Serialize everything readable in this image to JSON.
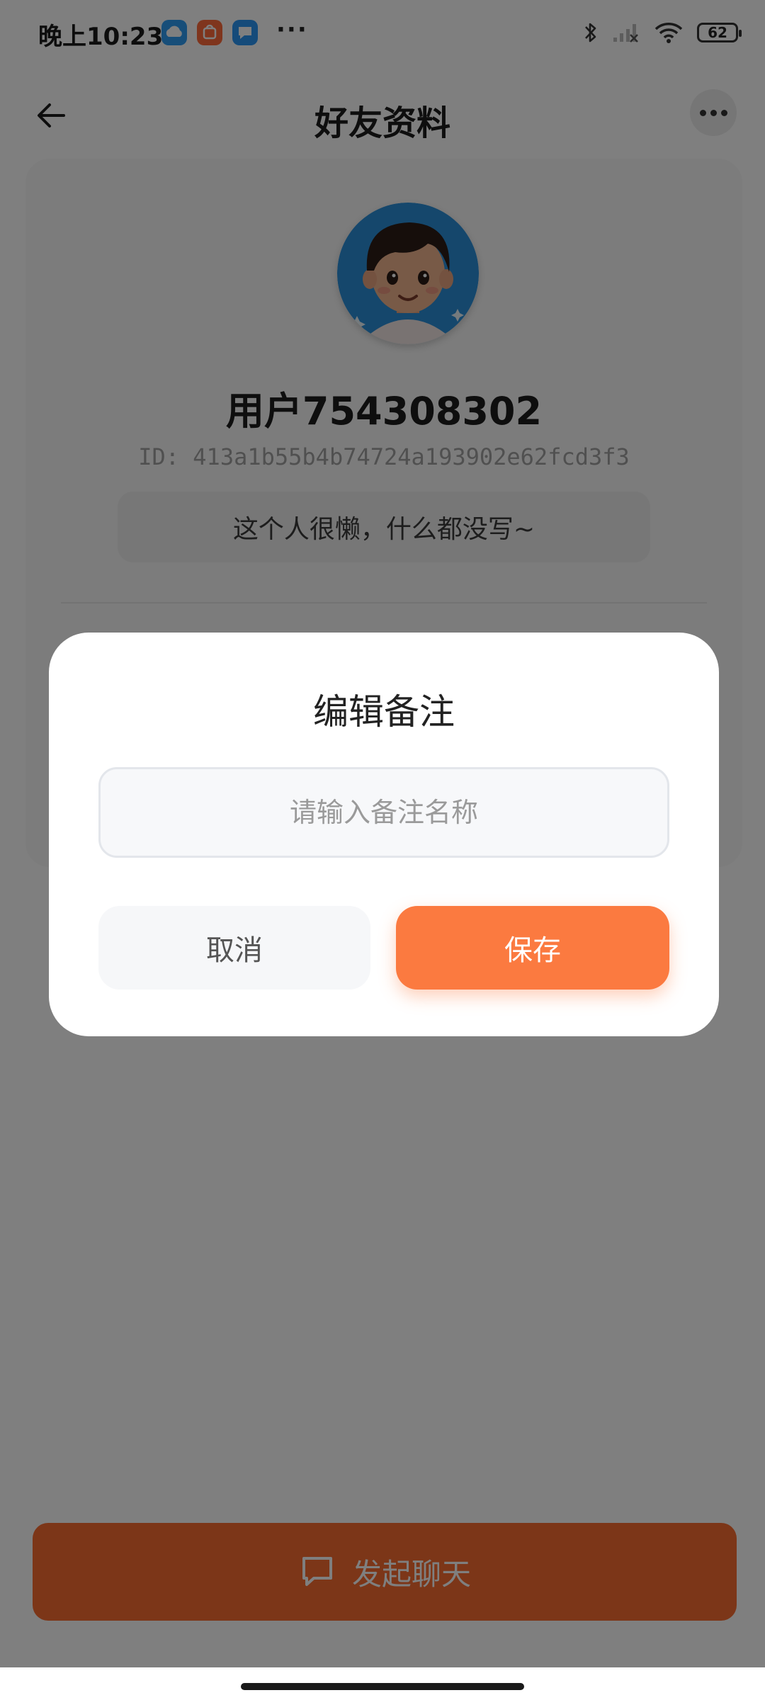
{
  "status_bar": {
    "time": "晚上10:23",
    "more": "···",
    "battery": "62",
    "icons": [
      "cloud-app-icon",
      "mi-store-app-icon",
      "message-app-icon",
      "bluetooth-icon",
      "signal-icon",
      "wifi-icon",
      "battery-icon"
    ]
  },
  "header": {
    "title": "好友资料",
    "back_icon": "arrow-left-icon",
    "more_icon": "more-dots-icon"
  },
  "profile": {
    "name": "用户754308302",
    "id_text": "ID: 413a1b55b4b74724a193902e62fcd3f3",
    "bio": "这个人很懒，什么都没写~"
  },
  "chat_button": {
    "label": "发起聊天",
    "icon": "chat-bubble-icon"
  },
  "dialog": {
    "title": "编辑备注",
    "input_value": "",
    "input_placeholder": "请输入备注名称",
    "cancel_label": "取消",
    "save_label": "保存"
  },
  "colors": {
    "accent": "#fb7a40",
    "overlay": "rgba(0,0,0,0.5)",
    "cloud_app": "#2f9cf3",
    "store_app": "#ff6a3a",
    "message_app": "#2b96f5"
  }
}
